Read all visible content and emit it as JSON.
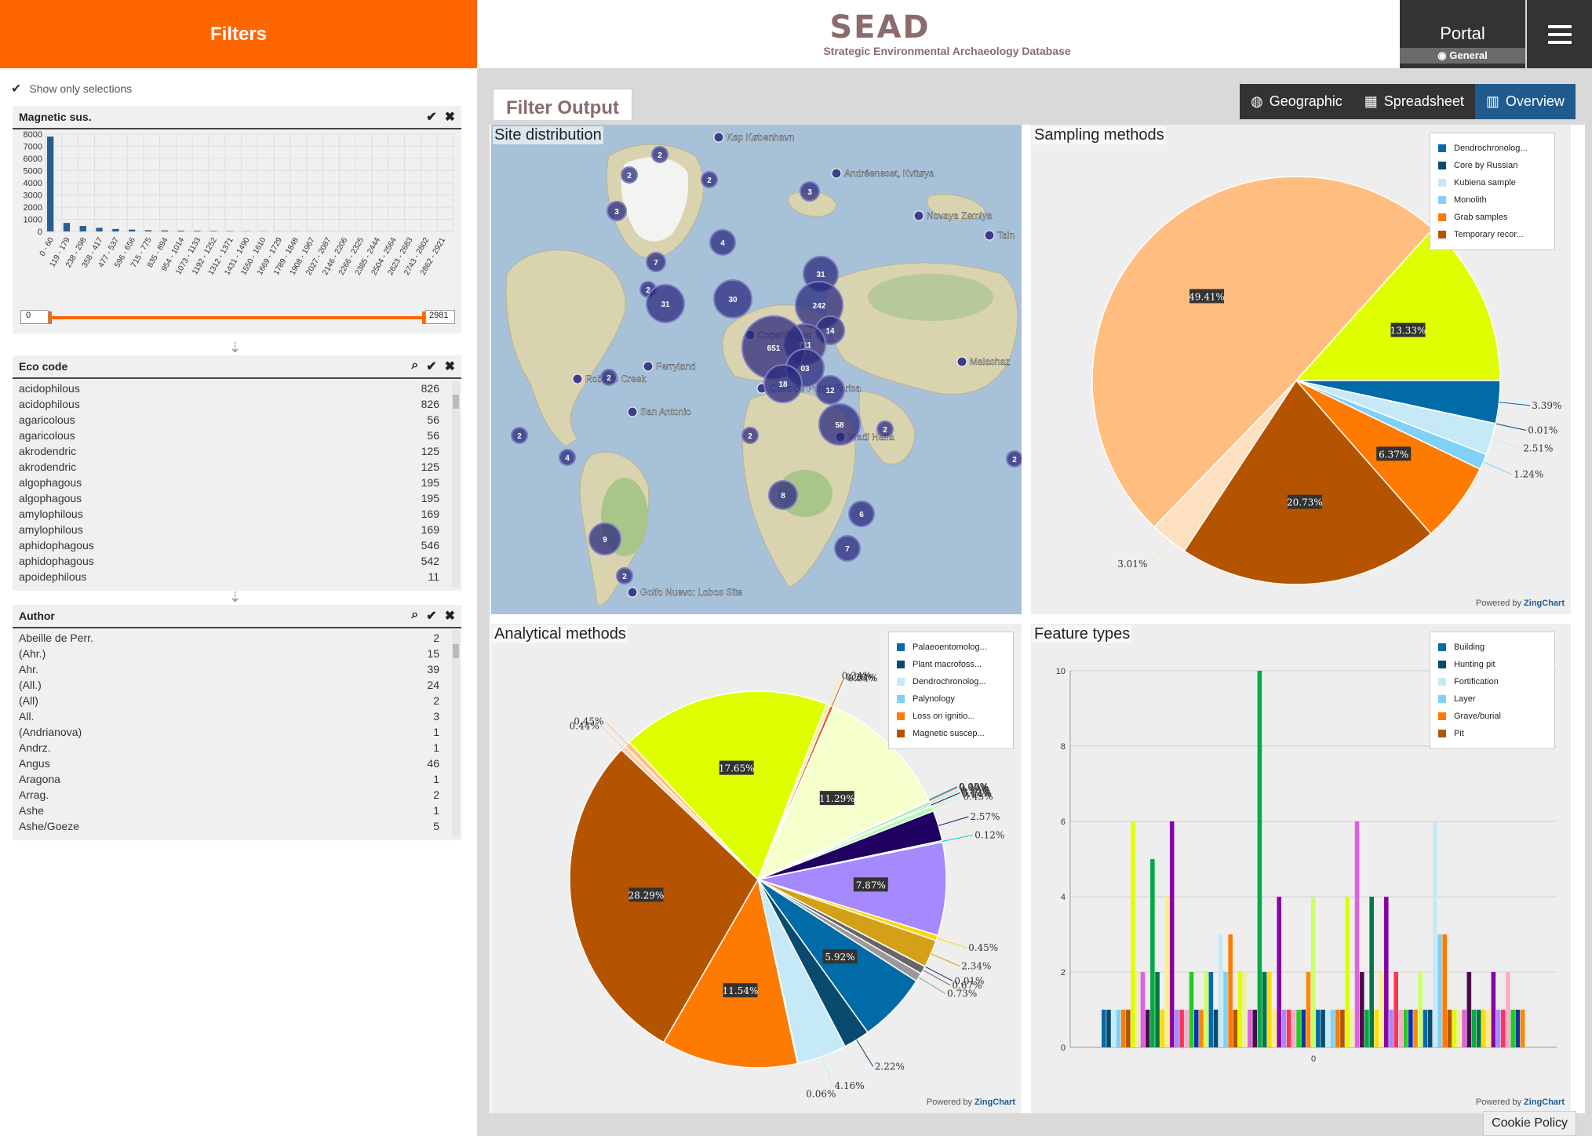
{
  "header": {
    "filters_title": "Filters",
    "logo_name": "SEAD",
    "logo_subtitle": "Strategic Environmental Archaeology Database",
    "portal_label": "Portal",
    "portal_sub": "General"
  },
  "filters": {
    "show_only": "Show only selections",
    "magnetic": {
      "title": "Magnetic sus.",
      "ylabels": [
        "8000",
        "7000",
        "6000",
        "5000",
        "4000",
        "3000",
        "2000",
        "1000",
        "0"
      ],
      "xlabels": [
        "0 - 60",
        "119 - 179",
        "238 - 298",
        "358 - 417",
        "477 - 537",
        "596 - 656",
        "715 - 775",
        "835 - 894",
        "954 - 1014",
        "1073 - 1133",
        "1192 - 1252",
        "1312 - 1371",
        "1431 - 1490",
        "1550 - 1610",
        "1669 - 1729",
        "1789 - 1848",
        "1908 - 1967",
        "2027 - 2087",
        "2146 - 2206",
        "2266 - 2325",
        "2385 - 2444",
        "2504 - 2564",
        "2623 - 2683",
        "2743 - 2802",
        "2862 - 2921"
      ],
      "bar_values": [
        7800,
        700,
        450,
        300,
        200,
        150,
        100,
        80,
        60,
        50,
        40,
        30,
        20,
        15,
        10,
        10,
        8,
        6,
        5,
        4,
        3,
        3,
        2,
        2,
        2
      ],
      "range_min": "0",
      "range_max": "2981"
    },
    "eco_code": {
      "title": "Eco code",
      "rows": [
        {
          "label": "acidophilous",
          "count": "826"
        },
        {
          "label": "acidophilous",
          "count": "826"
        },
        {
          "label": "agaricolous",
          "count": "56"
        },
        {
          "label": "agaricolous",
          "count": "56"
        },
        {
          "label": "akrodendric",
          "count": "125"
        },
        {
          "label": "akrodendric",
          "count": "125"
        },
        {
          "label": "algophagous",
          "count": "195"
        },
        {
          "label": "algophagous",
          "count": "195"
        },
        {
          "label": "amylophilous",
          "count": "169"
        },
        {
          "label": "amylophilous",
          "count": "169"
        },
        {
          "label": "aphidophagous",
          "count": "546"
        },
        {
          "label": "aphidophagous",
          "count": "542"
        },
        {
          "label": "apoidephilous",
          "count": "11"
        }
      ]
    },
    "author": {
      "title": "Author",
      "rows": [
        {
          "label": "Abeille de Perr.",
          "count": "2"
        },
        {
          "label": "(Ahr.)",
          "count": "15"
        },
        {
          "label": "Ahr.",
          "count": "39"
        },
        {
          "label": "(All.)",
          "count": "24"
        },
        {
          "label": "(All)",
          "count": "2"
        },
        {
          "label": "All.",
          "count": "3"
        },
        {
          "label": "(Andrianova)",
          "count": "1"
        },
        {
          "label": "Andrz.",
          "count": "1"
        },
        {
          "label": "Angus",
          "count": "46"
        },
        {
          "label": "Aragona",
          "count": "1"
        },
        {
          "label": "Arrag.",
          "count": "2"
        },
        {
          "label": "Ashe",
          "count": "1"
        },
        {
          "label": "Ashe/Goeze",
          "count": "5"
        }
      ]
    }
  },
  "output": {
    "tab_label": "Filter Output",
    "view_tabs": [
      "Geographic",
      "Spreadsheet",
      "Overview"
    ],
    "site_title": "Site distribution",
    "map_places": [
      {
        "name": "Kap København"
      },
      {
        "name": "Andréeneset, Kvitøya"
      },
      {
        "name": "Novaya Zemlya"
      },
      {
        "name": "Tain"
      },
      {
        "name": "Copenhagen"
      },
      {
        "name": "Ferryland"
      },
      {
        "name": "Roberts Creek"
      },
      {
        "name": "San Antonio"
      },
      {
        "name": "Cova de Punta Farisa"
      },
      {
        "name": "Wadi Halfa"
      },
      {
        "name": "Malashaz"
      },
      {
        "name": "Golfo Nuevo: Lobos Site"
      }
    ],
    "clusters": [
      "2",
      "2",
      "2",
      "3",
      "4",
      "7",
      "3",
      "2",
      "31",
      "30",
      "31",
      "242",
      "14",
      "711",
      "651",
      "03",
      "18",
      "12",
      "58",
      "2",
      "2",
      "8",
      "6",
      "7",
      "9",
      "2",
      "2",
      "4",
      "2",
      "2"
    ],
    "sampling_title": "Sampling methods",
    "analytical_title": "Analytical methods",
    "feature_title": "Feature types",
    "powered_by": "Powered by",
    "zingchart": "ZingChart",
    "cookie": "Cookie Policy"
  },
  "chart_data": [
    {
      "type": "bar",
      "title": "Magnetic sus.",
      "categories": [
        "0 - 60",
        "119 - 179",
        "238 - 298",
        "358 - 417",
        "477 - 537",
        "596 - 656",
        "715 - 775",
        "835 - 894",
        "954 - 1014",
        "1073 - 1133",
        "1192 - 1252",
        "1312 - 1371",
        "1431 - 1490",
        "1550 - 1610",
        "1669 - 1729",
        "1789 - 1848",
        "1908 - 1967",
        "2027 - 2087",
        "2146 - 2206",
        "2266 - 2325",
        "2385 - 2444",
        "2504 - 2564",
        "2623 - 2683",
        "2743 - 2802",
        "2862 - 2921"
      ],
      "values": [
        7800,
        700,
        450,
        300,
        200,
        150,
        100,
        80,
        60,
        50,
        40,
        30,
        20,
        15,
        10,
        10,
        8,
        6,
        5,
        4,
        3,
        3,
        2,
        2,
        2
      ],
      "ylim": [
        0,
        8000
      ]
    },
    {
      "type": "pie",
      "title": "Sampling methods",
      "slices": [
        {
          "name": "Dendrochronolog...",
          "value": 3.39,
          "label": "3.39%",
          "color": "#006ba6"
        },
        {
          "name": "Core by Russian",
          "value": 0.01,
          "label": "0.01%",
          "color": "#0a4a6e"
        },
        {
          "name": "Kubiena sample",
          "value": 2.51,
          "label": "2.51%",
          "color": "#c6e9f8"
        },
        {
          "name": "Monolith",
          "value": 1.24,
          "label": "1.24%",
          "color": "#7fd1f5"
        },
        {
          "name": "Grab samples",
          "value": 6.37,
          "label": "6.37%",
          "color": "#ff7a00"
        },
        {
          "name": "Temporary recor...",
          "value": 20.73,
          "label": "20.73%",
          "color": "#b55400"
        },
        {
          "name": "",
          "value": 3.01,
          "label": "3.01%",
          "color": "#fde0c0"
        },
        {
          "name": "",
          "value": 49.41,
          "label": "49.41%",
          "color": "#ffbe80"
        },
        {
          "name": "",
          "value": 13.33,
          "label": "13.33%",
          "color": "#dfff00"
        }
      ]
    },
    {
      "type": "pie",
      "title": "Analytical methods",
      "legend": [
        "Palaeoentomolog...",
        "Plant macrofoss...",
        "Dendrochronolog...",
        "Palynology",
        "Loss on ignitio...",
        "Magnetic suscep..."
      ],
      "slices": [
        {
          "value": 7.87,
          "label": "7.87%",
          "color": "#a688ff"
        },
        {
          "value": 0.45,
          "label": "0.45%",
          "color": "#ffd700"
        },
        {
          "value": 2.34,
          "label": "2.34%",
          "color": "#d4a017"
        },
        {
          "value": 0.01,
          "label": "0.01%",
          "color": "#222266"
        },
        {
          "value": 0.67,
          "label": "0.67%",
          "color": "#666666"
        },
        {
          "value": 0.73,
          "label": "0.73%",
          "color": "#999999"
        },
        {
          "value": 5.92,
          "label": "5.92%",
          "color": "#006ba6"
        },
        {
          "value": 2.22,
          "label": "2.22%",
          "color": "#0a4a6e"
        },
        {
          "value": 4.16,
          "label": "4.16%",
          "color": "#c6e9f8"
        },
        {
          "value": 0.06,
          "label": "0.06%",
          "color": "#e0f0ff"
        },
        {
          "value": 11.54,
          "label": "11.54%",
          "color": "#ff7a00"
        },
        {
          "value": 28.29,
          "label": "28.29%",
          "color": "#b55400"
        },
        {
          "value": 0.44,
          "label": "0.44%",
          "color": "#ffd0b0"
        },
        {
          "value": 0.45,
          "label": "0.45%",
          "color": "#ffbe80"
        },
        {
          "value": 17.65,
          "label": "17.65%",
          "color": "#dfff00"
        },
        {
          "value": 0.34,
          "label": "0.34%",
          "color": "#f0f0a0"
        },
        {
          "value": 0.28,
          "label": "0.28%",
          "color": "#e06020"
        },
        {
          "value": 0.04,
          "label": "0.04%",
          "color": "#f5ffcc"
        },
        {
          "value": 11.29,
          "label": "11.29%",
          "color": "#f5ffcc"
        },
        {
          "value": 0.0,
          "label": "0.00%",
          "color": "#2c1a7a"
        },
        {
          "value": 0.03,
          "label": "0.03%",
          "color": "#1ab"
        },
        {
          "value": 0.1,
          "label": "0.10%",
          "color": "#e88"
        },
        {
          "value": 0.28,
          "label": "0.28%",
          "color": "#a0f0a0"
        },
        {
          "value": 0.12,
          "label": "0.12%",
          "color": "#0a0a4a"
        },
        {
          "value": 0.04,
          "label": "0.04%",
          "color": "#eaeaff"
        },
        {
          "value": 0.43,
          "label": "0.43%",
          "color": "#b0ffb0"
        },
        {
          "value": 2.57,
          "label": "2.57%",
          "color": "#200060"
        },
        {
          "value": 0.12,
          "label": "0.12%",
          "color": "#00cccc"
        }
      ]
    },
    {
      "type": "bar",
      "title": "Feature types",
      "legend": [
        "Building",
        "Hunting pit",
        "Fortification",
        "Layer",
        "Grave/burial",
        "Pit"
      ],
      "categories": [
        "0"
      ],
      "ylim": [
        0,
        10
      ],
      "yticks": [
        "10",
        "8",
        "6",
        "4",
        "2",
        "0"
      ],
      "values": [
        1,
        1,
        1,
        1,
        1,
        1,
        6,
        2,
        2,
        1,
        5,
        2,
        1,
        4,
        6,
        1,
        1,
        1,
        2,
        1,
        1,
        2,
        2,
        1,
        3,
        2,
        3,
        1,
        2,
        2,
        1,
        1,
        10,
        2,
        2,
        1,
        4,
        1,
        1,
        1,
        1,
        1,
        2,
        4,
        1,
        1,
        1,
        1,
        1,
        1,
        4,
        1,
        6,
        2,
        1,
        4,
        1,
        2,
        4,
        1,
        2,
        1,
        1,
        1,
        1,
        2,
        1,
        1,
        6,
        3,
        3,
        1,
        1,
        1,
        1,
        2,
        1,
        1,
        1,
        1,
        2,
        1,
        1,
        2,
        1,
        1,
        1
      ]
    }
  ]
}
